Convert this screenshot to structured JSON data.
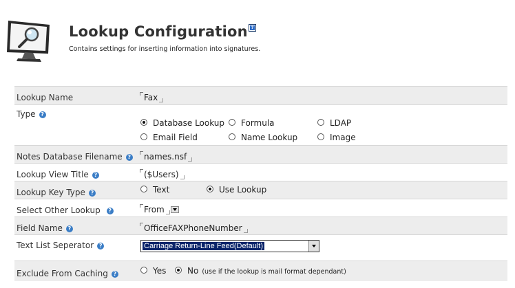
{
  "header": {
    "title": "Lookup Configuration",
    "subtitle": "Contains settings for inserting information into signatures.",
    "help_glyph": "?"
  },
  "form": {
    "lookup_name": {
      "label": "Lookup Name",
      "value": "Fax"
    },
    "type": {
      "label": "Type",
      "options": [
        "Database Lookup",
        "Formula",
        "LDAP",
        "Email Field",
        "Name Lookup",
        "Image"
      ],
      "selected": "Database Lookup"
    },
    "notes_db": {
      "label": "Notes Database Filename",
      "value": "names.nsf"
    },
    "view_title": {
      "label": "Lookup View Title",
      "value": "($Users)"
    },
    "key_type": {
      "label": "Lookup Key Type",
      "options": [
        "Text",
        "Use Lookup"
      ],
      "selected": "Use Lookup"
    },
    "other_lookup": {
      "label": "Select Other Lookup",
      "value": "From"
    },
    "field_name": {
      "label": "Field Name",
      "value": "OfficeFAXPhoneNumber"
    },
    "separator": {
      "label": "Text List Seperator",
      "value": "Carriage Return-Line Feed(Default)"
    },
    "caching": {
      "label": "Exclude From Caching",
      "options": [
        "Yes",
        "No"
      ],
      "selected": "No",
      "note": "(use if the lookup is mail format dependant)"
    }
  },
  "colors": {
    "row_grey": "#ededed",
    "help_blue": "#3a7dc6",
    "selection_navy": "#0a246a"
  }
}
